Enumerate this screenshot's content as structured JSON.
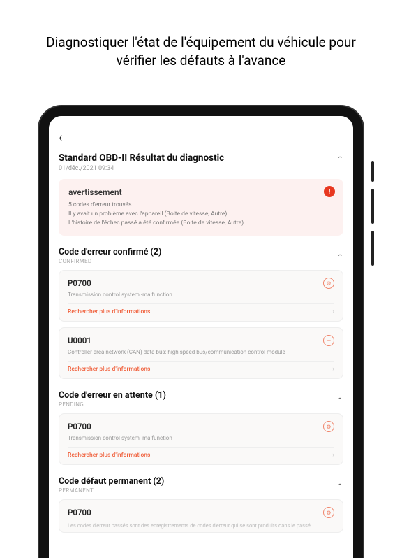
{
  "headline": "Diagnostiquer l'état de l'équipement du véhicule pour vérifier les défauts à l'avance",
  "backGlyph": "‹",
  "chevronUp": "⌃",
  "main": {
    "title": "Standard OBD-II Résultat du diagnostic",
    "date": "01/déc./2021 09:34"
  },
  "warning": {
    "title": "avertissement",
    "line1": "5 codes d'erreur trouvés",
    "line2": "Il y avait un problème avec l'appareil.(Boite de vitesse, Autre)",
    "line3": "L'histoire de l'échec passé a été confirmée.(Boite de vitesse, Autre)",
    "badge": "!"
  },
  "sections": {
    "confirmed": {
      "title": "Code d'erreur confirmé (2)",
      "tag": "CONFIRMED"
    },
    "pending": {
      "title": "Code d'erreur en attente (1)",
      "tag": "PENDING"
    },
    "permanent": {
      "title": "Code défaut permanent (2)",
      "tag": "PERMANENT"
    }
  },
  "codes": {
    "p0700": {
      "id": "P0700",
      "desc": "Transmission control system -malfunction",
      "link": "Rechercher plus d'informations"
    },
    "u0001": {
      "id": "U0001",
      "desc": "Controller area network (CAN) data bus: high speed bus/communication control module",
      "link": "Rechercher plus d'informations"
    }
  },
  "footnote": "Les codes d'erreur passés sont des enregistrements de codes d'erreur qui se sont produits dans le passé.",
  "iconGlyph": "⚙",
  "arrowGlyph": "›"
}
